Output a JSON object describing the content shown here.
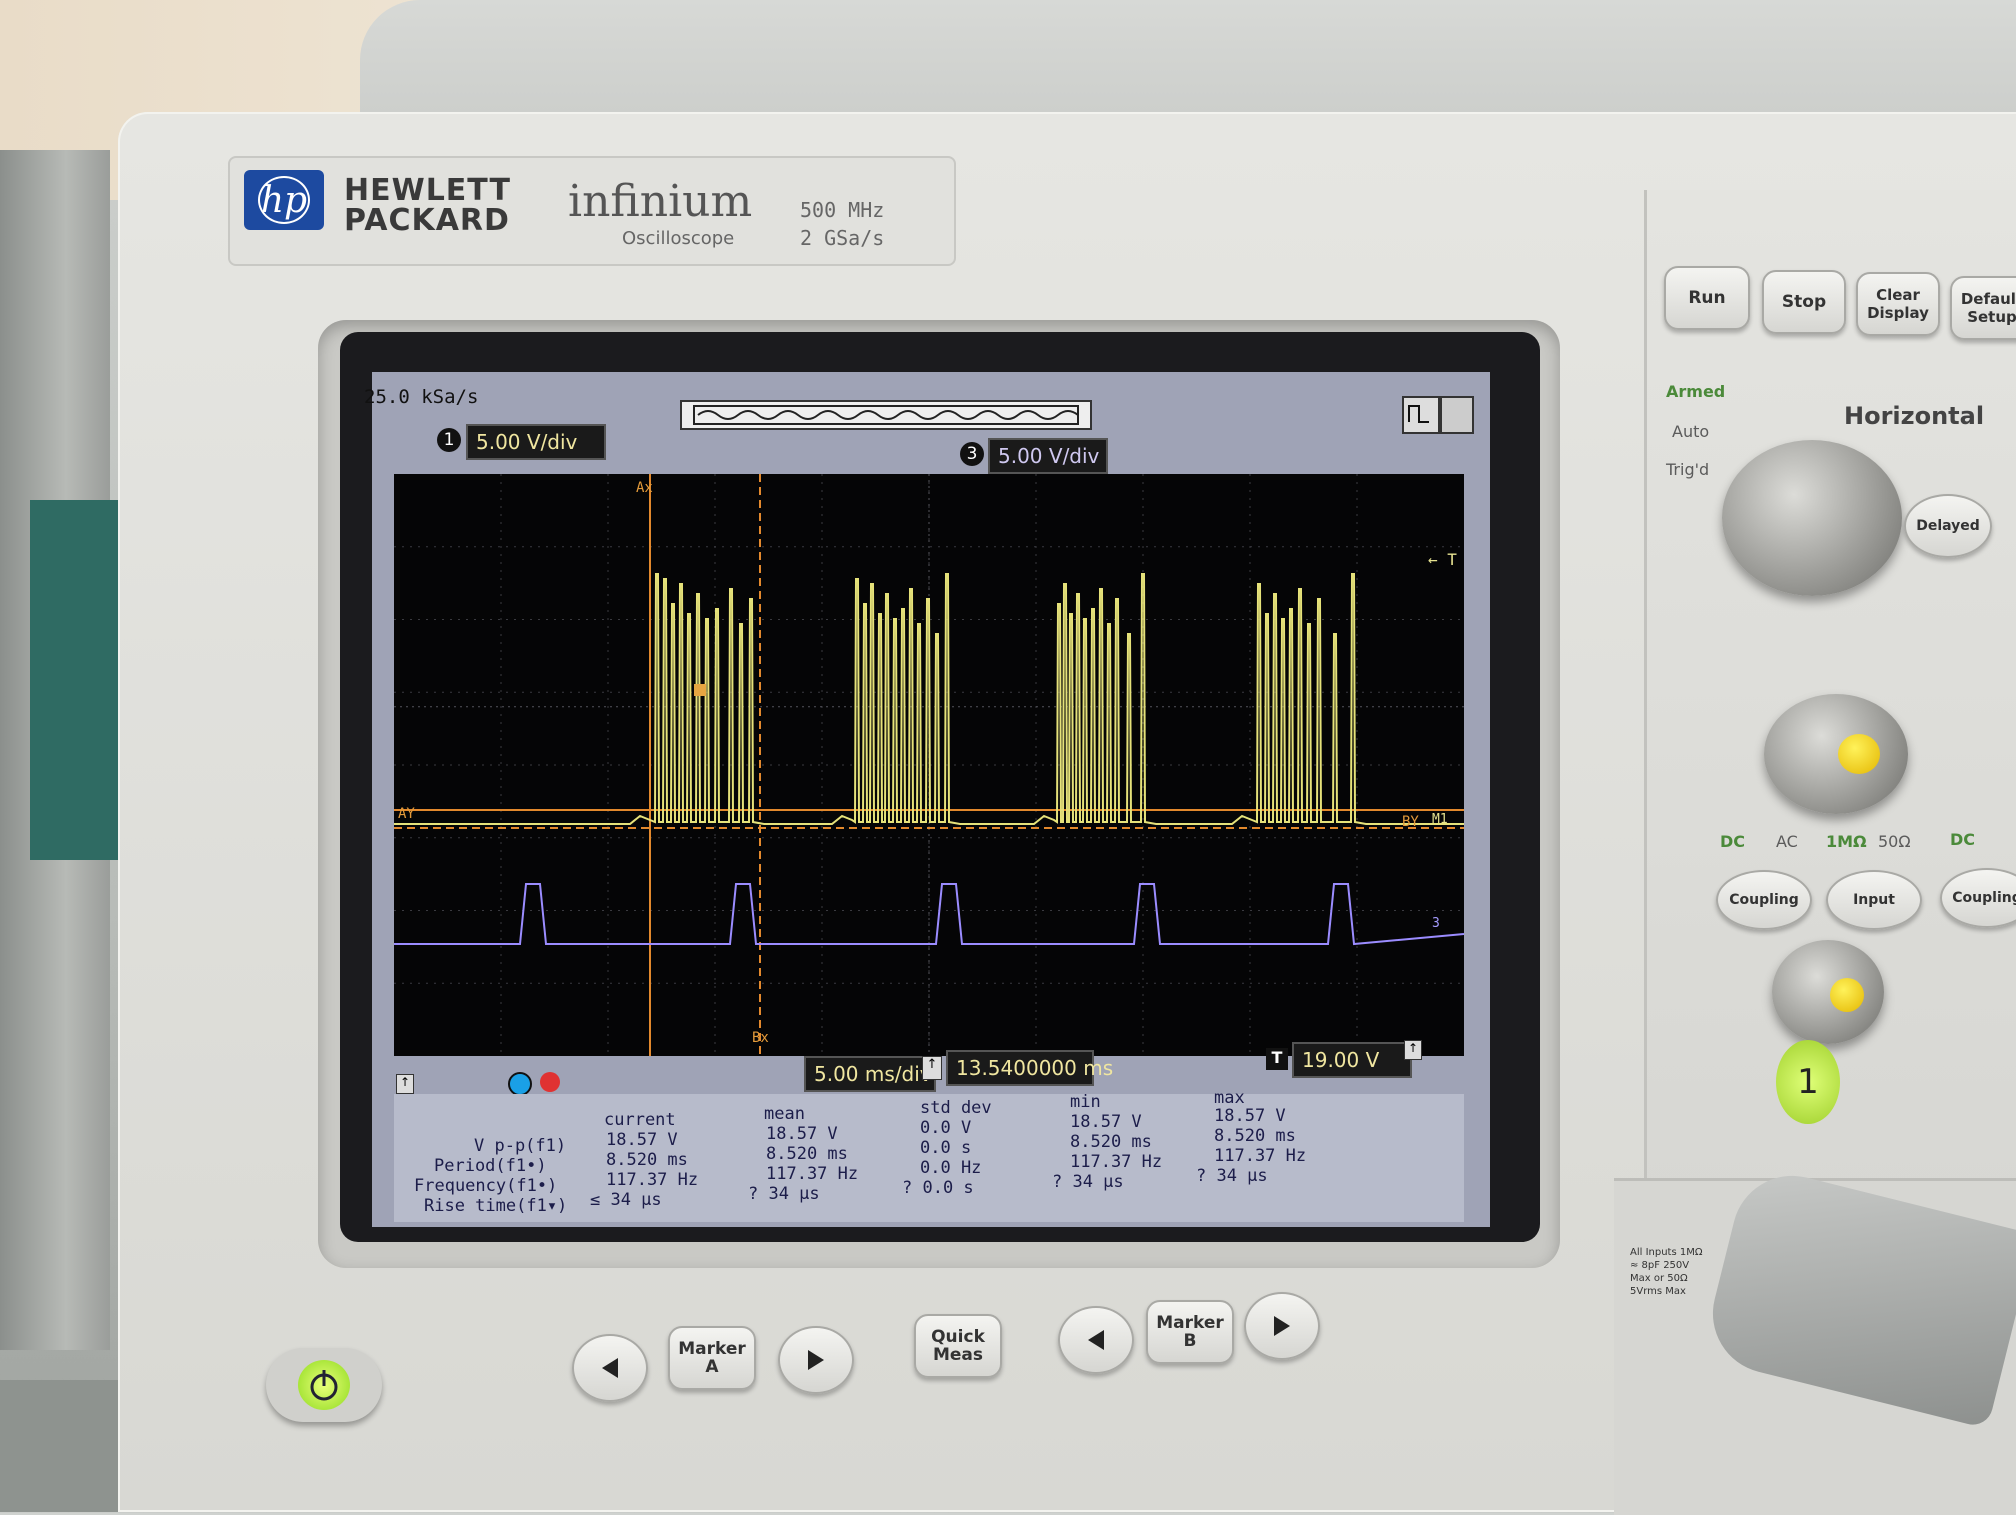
{
  "brand": {
    "line1": "HEWLETT",
    "line2": "PACKARD",
    "logo": "hp",
    "product": "infinium",
    "product_sub": "Oscilloscope",
    "spec_bw": "500 MHz",
    "spec_sr": "2 GSa/s"
  },
  "screen": {
    "sample_rate": "25.0 kSa/s",
    "ch1_scale": "5.00 V/div",
    "ch1_num": "1",
    "ch3_scale": "5.00 V/div",
    "ch3_num": "3",
    "time_div": "5.00 ms/div",
    "delay": "13.5400000 ms",
    "trig_level": "19.00 V",
    "trig_icon": "T",
    "markers": {
      "ax": "Ax",
      "bx": "Bx",
      "ay": "AY",
      "by": "BY",
      "t": "← T",
      "m1": "M1",
      "m3": "3"
    }
  },
  "measurements": {
    "headers": {
      "current": "current",
      "mean": "mean",
      "std": "std dev",
      "min": "min",
      "max": "max"
    },
    "rows": [
      {
        "name": "V p-p(f1)",
        "current": "18.57 V",
        "mean": "18.57 V",
        "std": "0.0 V",
        "min": "18.57 V",
        "max": "18.57 V"
      },
      {
        "name": "Period(f1•)",
        "current": "8.520 ms",
        "mean": "8.520 ms",
        "std": "0.0 s",
        "min": "8.520 ms",
        "max": "8.520 ms"
      },
      {
        "name": "Frequency(f1•)",
        "current": "117.37 Hz",
        "mean": "117.37 Hz",
        "std": "0.0 Hz",
        "min": "117.37 Hz",
        "max": "117.37 Hz"
      },
      {
        "name": "Rise time(f1▾)",
        "current": "≤ 34 µs",
        "mean": "? 34 µs",
        "std": "? 0.0 s",
        "min": "? 34 µs",
        "max": "? 34 µs"
      }
    ]
  },
  "front_panel": {
    "run": "Run",
    "stop": "Stop",
    "clear_display": "Clear Display",
    "default_setup": "Default Setup",
    "armed": "Armed",
    "auto": "Auto",
    "trigd": "Trig'd",
    "horizontal": "Horizontal",
    "delayed": "Delayed",
    "dc": "DC",
    "ac": "AC",
    "imp1": "1MΩ",
    "imp50": "50Ω",
    "coupling": "Coupling",
    "input": "Input",
    "ch1_button": "1",
    "marker_a": "Marker A",
    "marker_b": "Marker B",
    "quick_meas": "Quick Meas",
    "inputs_note": "All Inputs 1MΩ ≈ 8pF 250V Max or 50Ω 5Vrms Max"
  }
}
